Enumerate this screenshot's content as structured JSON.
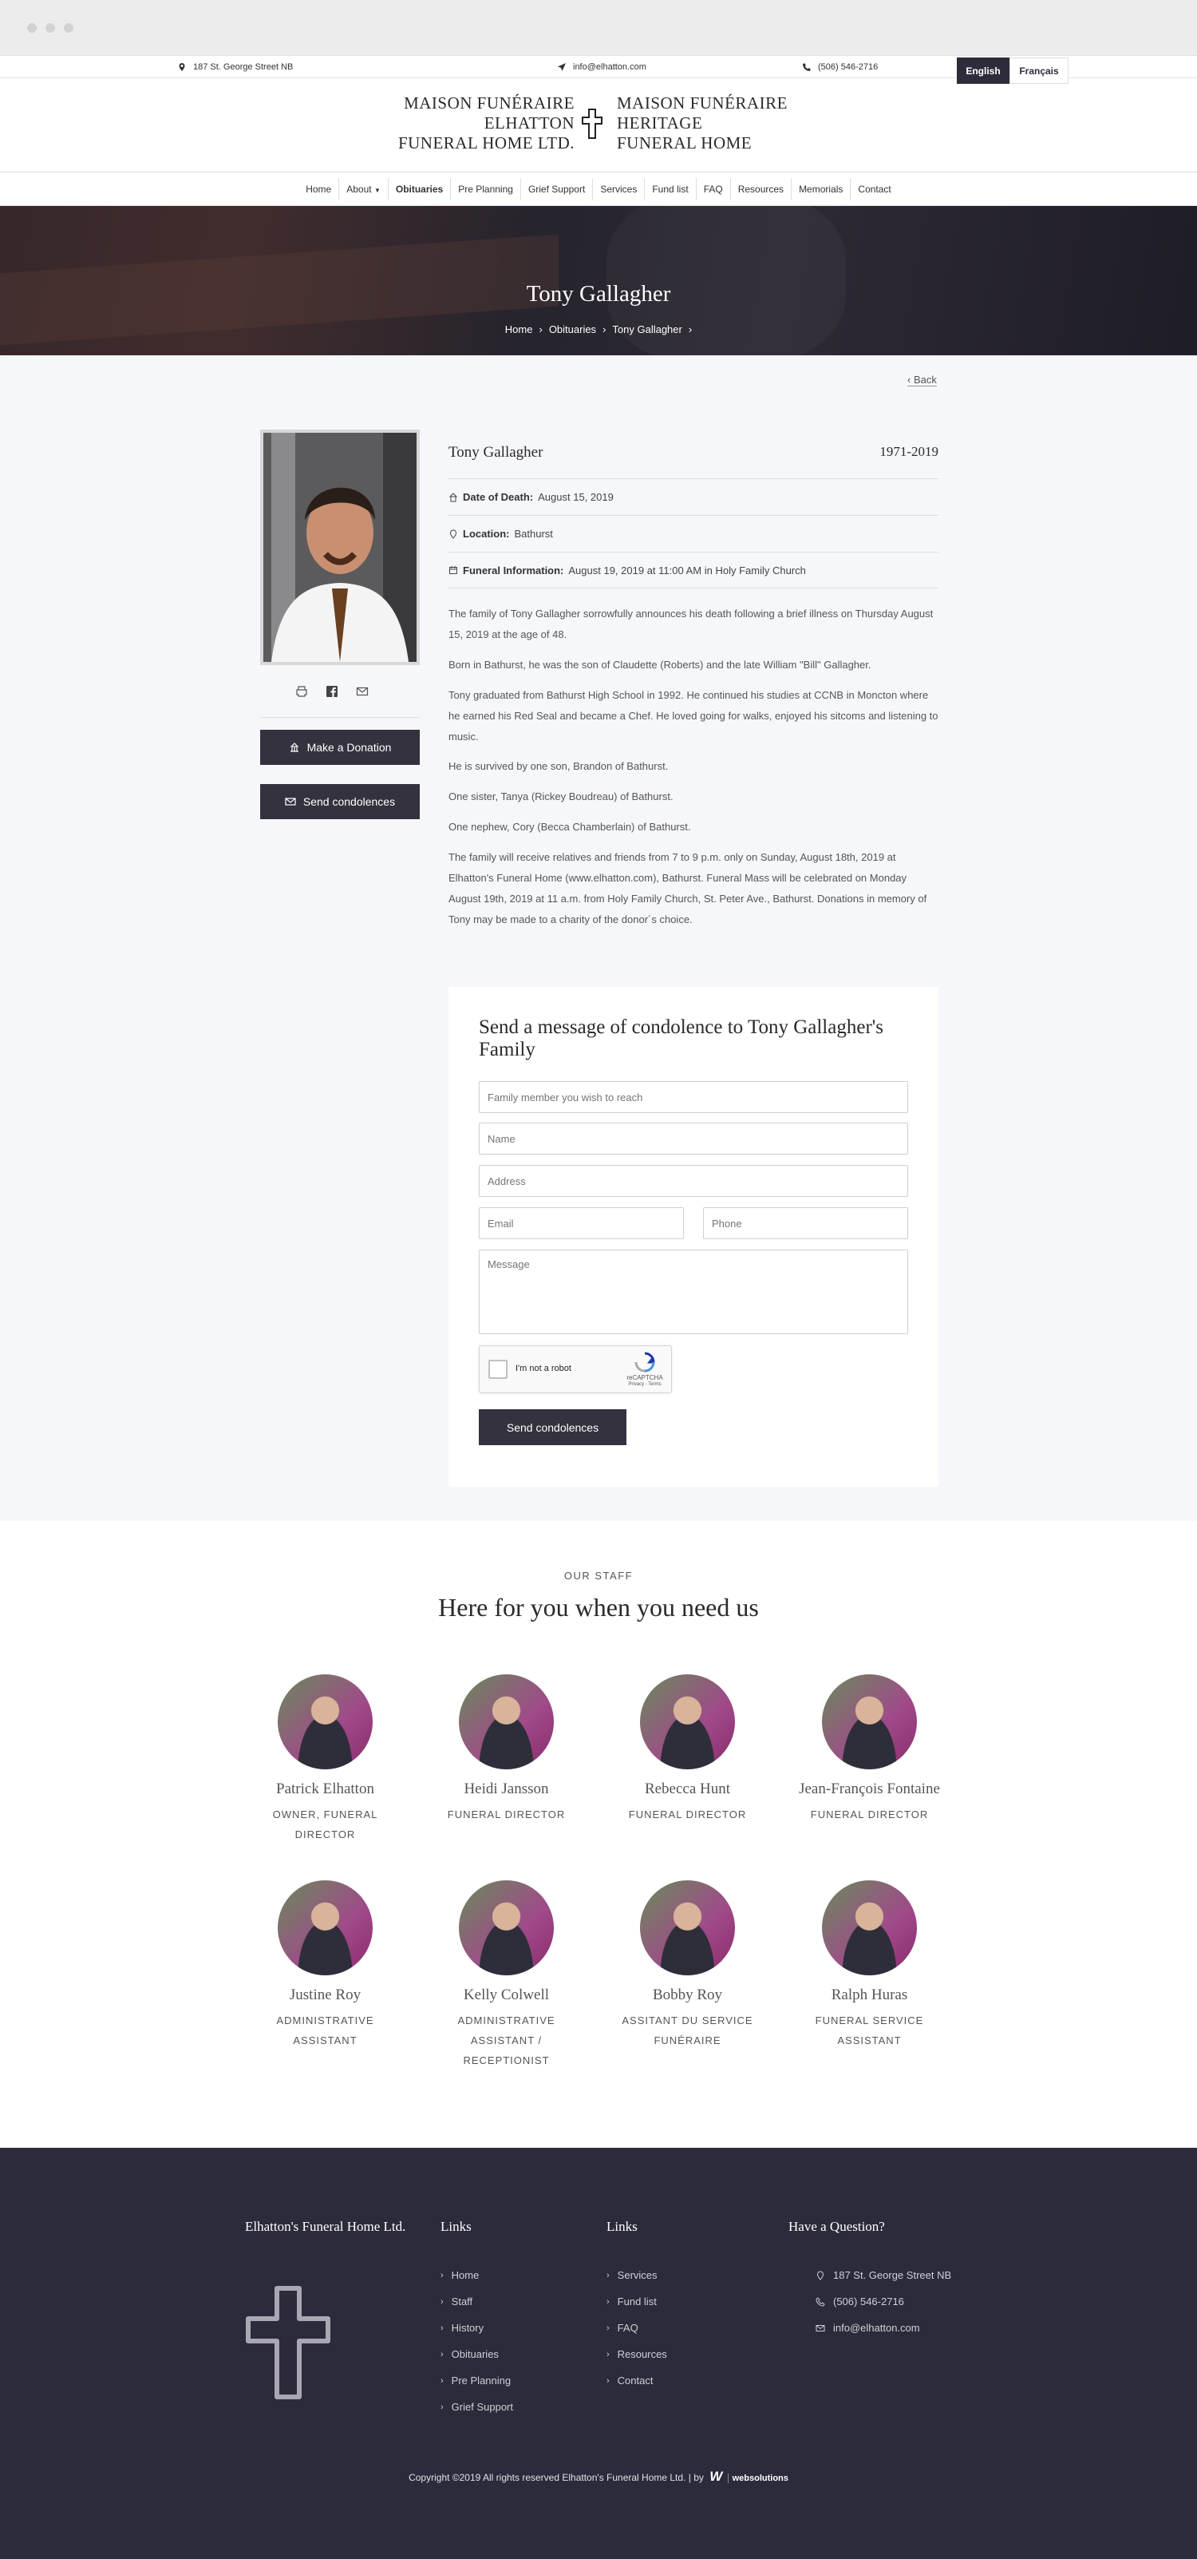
{
  "topbar": {
    "address": "187 St. George Street NB",
    "email": "info@elhatton.com",
    "phone": "(506) 546-2716",
    "lang_en": "English",
    "lang_fr": "Français"
  },
  "logo": {
    "left": [
      "MAISON FUNÉRAIRE",
      "ELHATTON",
      "FUNERAL HOME LTD."
    ],
    "right": [
      "MAISON FUNÉRAIRE",
      "HERITAGE",
      "FUNERAL HOME"
    ]
  },
  "nav": [
    "Home",
    "About",
    "Obituaries",
    "Pre Planning",
    "Grief Support",
    "Services",
    "Fund list",
    "FAQ",
    "Resources",
    "Memorials",
    "Contact"
  ],
  "hero": {
    "title": "Tony Gallagher",
    "crumbs": [
      "Home",
      "Obituaries",
      "Tony Gallagher"
    ]
  },
  "back": "Back",
  "obit": {
    "name": "Tony Gallagher",
    "years": "1971-2019",
    "death_label": "Date of Death:",
    "death_value": "August 15, 2019",
    "location_label": "Location:",
    "location_value": "Bathurst",
    "funeral_label": "Funeral Information:",
    "funeral_value": "August 19, 2019 at 11:00 AM in Holy Family Church",
    "paragraphs": [
      "The family of Tony Gallagher sorrowfully announces his death following a brief illness on Thursday August 15, 2019 at the age of 48.",
      "Born in Bathurst, he was the son of Claudette (Roberts) and the late William \"Bill\" Gallagher.",
      "Tony graduated from Bathurst High School in 1992. He continued his studies at CCNB in Moncton where he earned his Red Seal and became a Chef. He loved going for walks, enjoyed his sitcoms and listening to music.",
      "He is survived by one son, Brandon of Bathurst.",
      "One sister, Tanya (Rickey Boudreau) of Bathurst.",
      "One nephew, Cory (Becca Chamberlain) of Bathurst.",
      "The family will receive relatives and friends from 7 to 9 p.m. only on Sunday, August 18th, 2019 at Elhatton's Funeral Home (www.elhatton.com), Bathurst. Funeral Mass will be celebrated on Monday August 19th, 2019 at 11 a.m. from Holy Family Church, St. Peter Ave., Bathurst. Donations in memory of Tony may be made to a charity of the donor´s choice."
    ],
    "donation_btn": "Make a Donation",
    "condolence_btn": "Send condolences"
  },
  "form": {
    "title": "Send a message of condolence to Tony Gallagher's Family",
    "family_ph": "Family member you wish to reach",
    "name_ph": "Name",
    "address_ph": "Address",
    "email_ph": "Email",
    "phone_ph": "Phone",
    "message_ph": "Message",
    "captcha_label": "I'm not a robot",
    "captcha_brand": "reCAPTCHA",
    "captcha_links": "Privacy - Terms",
    "submit": "Send condolences"
  },
  "staff": {
    "label": "OUR STAFF",
    "heading": "Here for you when you need us",
    "members": [
      {
        "name": "Patrick Elhatton",
        "role": [
          "OWNER, FUNERAL",
          "DIRECTOR"
        ]
      },
      {
        "name": "Heidi Jansson",
        "role": [
          "FUNERAL DIRECTOR"
        ]
      },
      {
        "name": "Rebecca Hunt",
        "role": [
          "FUNERAL DIRECTOR"
        ]
      },
      {
        "name": "Jean-François Fontaine",
        "role": [
          "FUNERAL DIRECTOR"
        ]
      },
      {
        "name": "Justine Roy",
        "role": [
          "ADMINISTRATIVE",
          "ASSISTANT"
        ]
      },
      {
        "name": "Kelly Colwell",
        "role": [
          "ADMINISTRATIVE",
          "ASSISTANT /",
          "RECEPTIONIST"
        ]
      },
      {
        "name": "Bobby Roy",
        "role": [
          "ASSITANT DU SERVICE",
          "FUNÉRAIRE"
        ]
      },
      {
        "name": "Ralph Huras",
        "role": [
          "FUNERAL SERVICE",
          "ASSISTANT"
        ]
      }
    ]
  },
  "footer": {
    "brand": "Elhatton's Funeral Home Ltd.",
    "links_title": "Links",
    "links1": [
      "Home",
      "Staff",
      "History",
      "Obituaries",
      "Pre Planning",
      "Grief Support"
    ],
    "links2": [
      "Services",
      "Fund list",
      "FAQ",
      "Resources",
      "Contact"
    ],
    "question_title": "Have a Question?",
    "address": "187 St. George Street NB",
    "phone": "(506) 546-2716",
    "email": "info@elhatton.com",
    "copyright": "Copyright ©2019 All rights reserved Elhatton's Funeral Home Ltd.  |  by",
    "credit": "websolutions"
  }
}
